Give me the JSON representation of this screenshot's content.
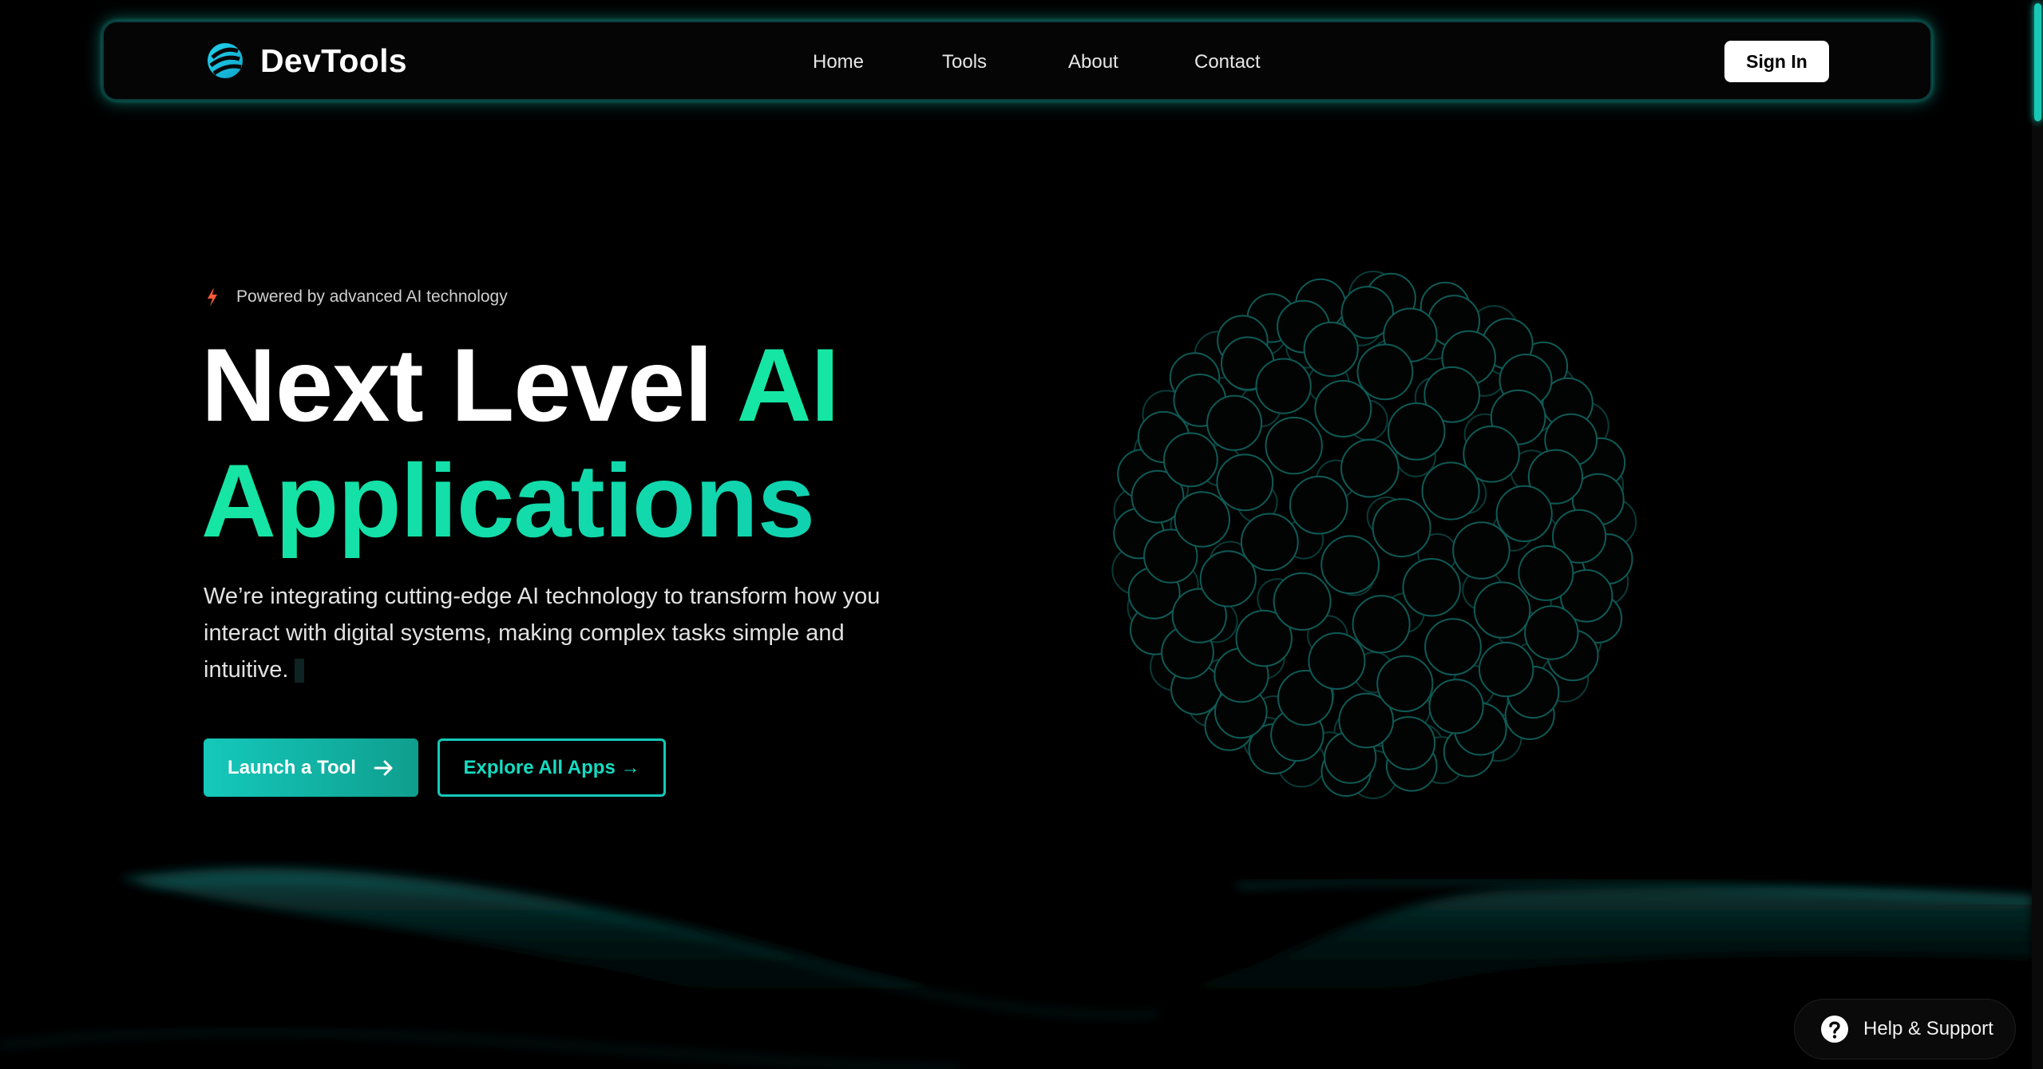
{
  "nav": {
    "brand": "DevTools",
    "links": [
      "Home",
      "Tools",
      "About",
      "Contact"
    ],
    "signin_label": "Sign In"
  },
  "hero": {
    "badge": "Powered by advanced AI technology",
    "headline_white": "Next Level ",
    "headline_accent": "AI",
    "headline_line2": "Applications",
    "subtitle": "We’re integrating cutting-edge AI technology to transform how you interact with digital systems, making complex tasks simple and intuitive.",
    "primary_cta": "Launch a Tool",
    "secondary_cta": "Explore All Apps →"
  },
  "help": {
    "label": "Help & Support"
  },
  "icons": {
    "logo": "logo-icon",
    "badge": "lightning-bolt-icon",
    "primary_cta": "arrow-right-icon",
    "help": "question-mark-icon"
  },
  "colors": {
    "accent": "#16e6a4",
    "teal": "#14c9bb",
    "bolt": "#ff5a3c",
    "background": "#000000"
  }
}
